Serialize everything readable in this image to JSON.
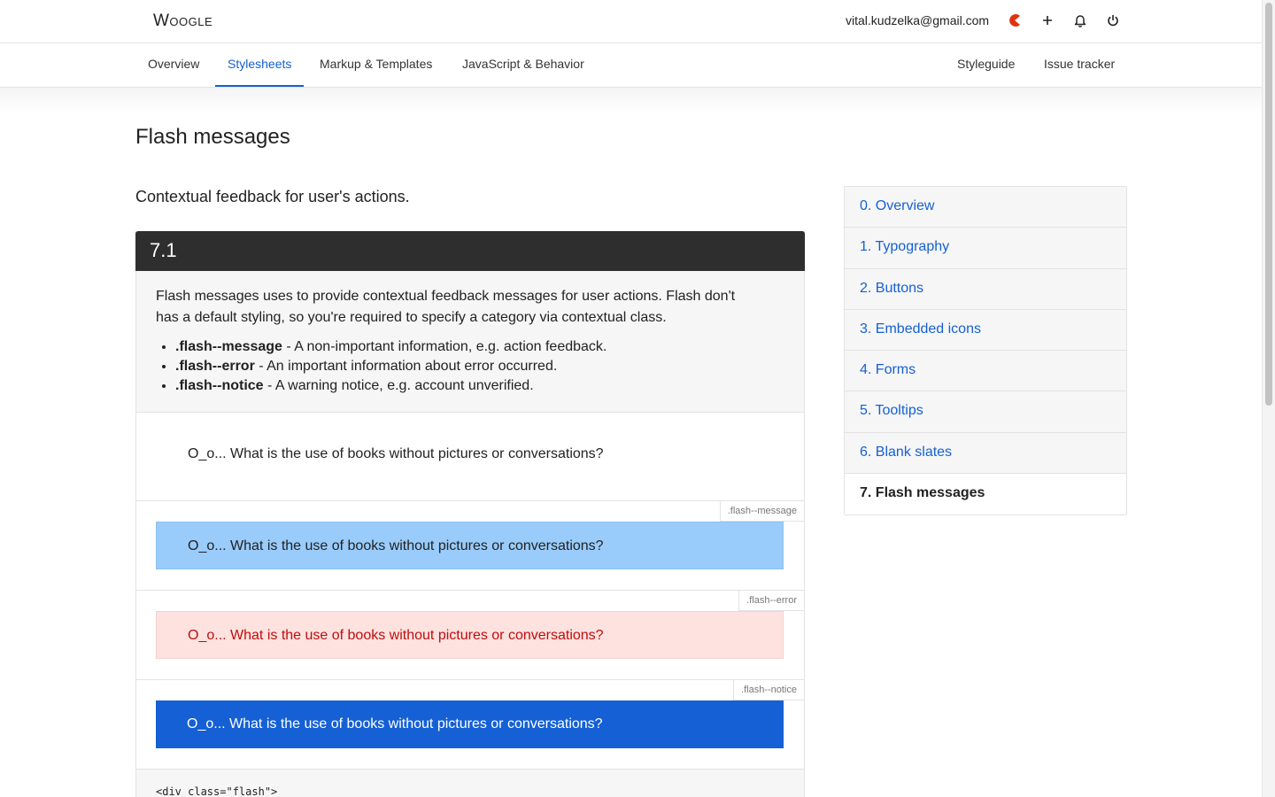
{
  "header": {
    "logo": "Woogle",
    "user_email": "vital.kudzelka@gmail.com",
    "icons": [
      "pacman-icon",
      "plus-icon",
      "bell-icon",
      "power-icon"
    ],
    "accent_color": "#e0330d"
  },
  "nav": {
    "items": [
      {
        "label": "Overview",
        "active": false
      },
      {
        "label": "Stylesheets",
        "active": true
      },
      {
        "label": "Markup & Templates",
        "active": false
      },
      {
        "label": "JavaScript & Behavior",
        "active": false
      }
    ],
    "right_items": [
      {
        "label": "Styleguide"
      },
      {
        "label": "Issue tracker"
      }
    ],
    "active_color": "#1560d4"
  },
  "page": {
    "title": "Flash messages",
    "lead": "Contextual feedback for user's actions."
  },
  "section": {
    "number": "7.1",
    "description": "Flash messages uses to provide contextual feedback messages for user actions. Flash don't has a default styling, so you're required to specify a category via contextual class.",
    "modifiers": [
      {
        "name": ".flash--message",
        "text": " - A non-important information, e.g. action feedback."
      },
      {
        "name": ".flash--error",
        "text": " - An important information about error occurred."
      },
      {
        "name": ".flash--notice",
        "text": " - A warning notice, e.g. account unverified."
      }
    ],
    "examples": [
      {
        "tag": "",
        "text": "O_o... What is the use of books without pictures or conversations?"
      },
      {
        "tag": ".flash--message",
        "text": "O_o... What is the use of books without pictures or conversations?"
      },
      {
        "tag": ".flash--error",
        "text": "O_o... What is the use of books without pictures or conversations?"
      },
      {
        "tag": ".flash--notice",
        "text": "O_o... What is the use of books without pictures or conversations?"
      }
    ],
    "code": "<div class=\"flash\">"
  },
  "sidebar": {
    "items": [
      {
        "label": "0. Overview"
      },
      {
        "label": "1. Typography"
      },
      {
        "label": "2. Buttons"
      },
      {
        "label": "3. Embedded icons"
      },
      {
        "label": "4. Forms"
      },
      {
        "label": "5. Tooltips"
      },
      {
        "label": "6. Blank slates"
      },
      {
        "label": "7. Flash messages",
        "current": true
      }
    ]
  },
  "colors": {
    "message_bg": "#99cbfb",
    "error_bg": "#fde2df",
    "error_text": "#c00d0d",
    "notice_bg": "#1560d4"
  }
}
